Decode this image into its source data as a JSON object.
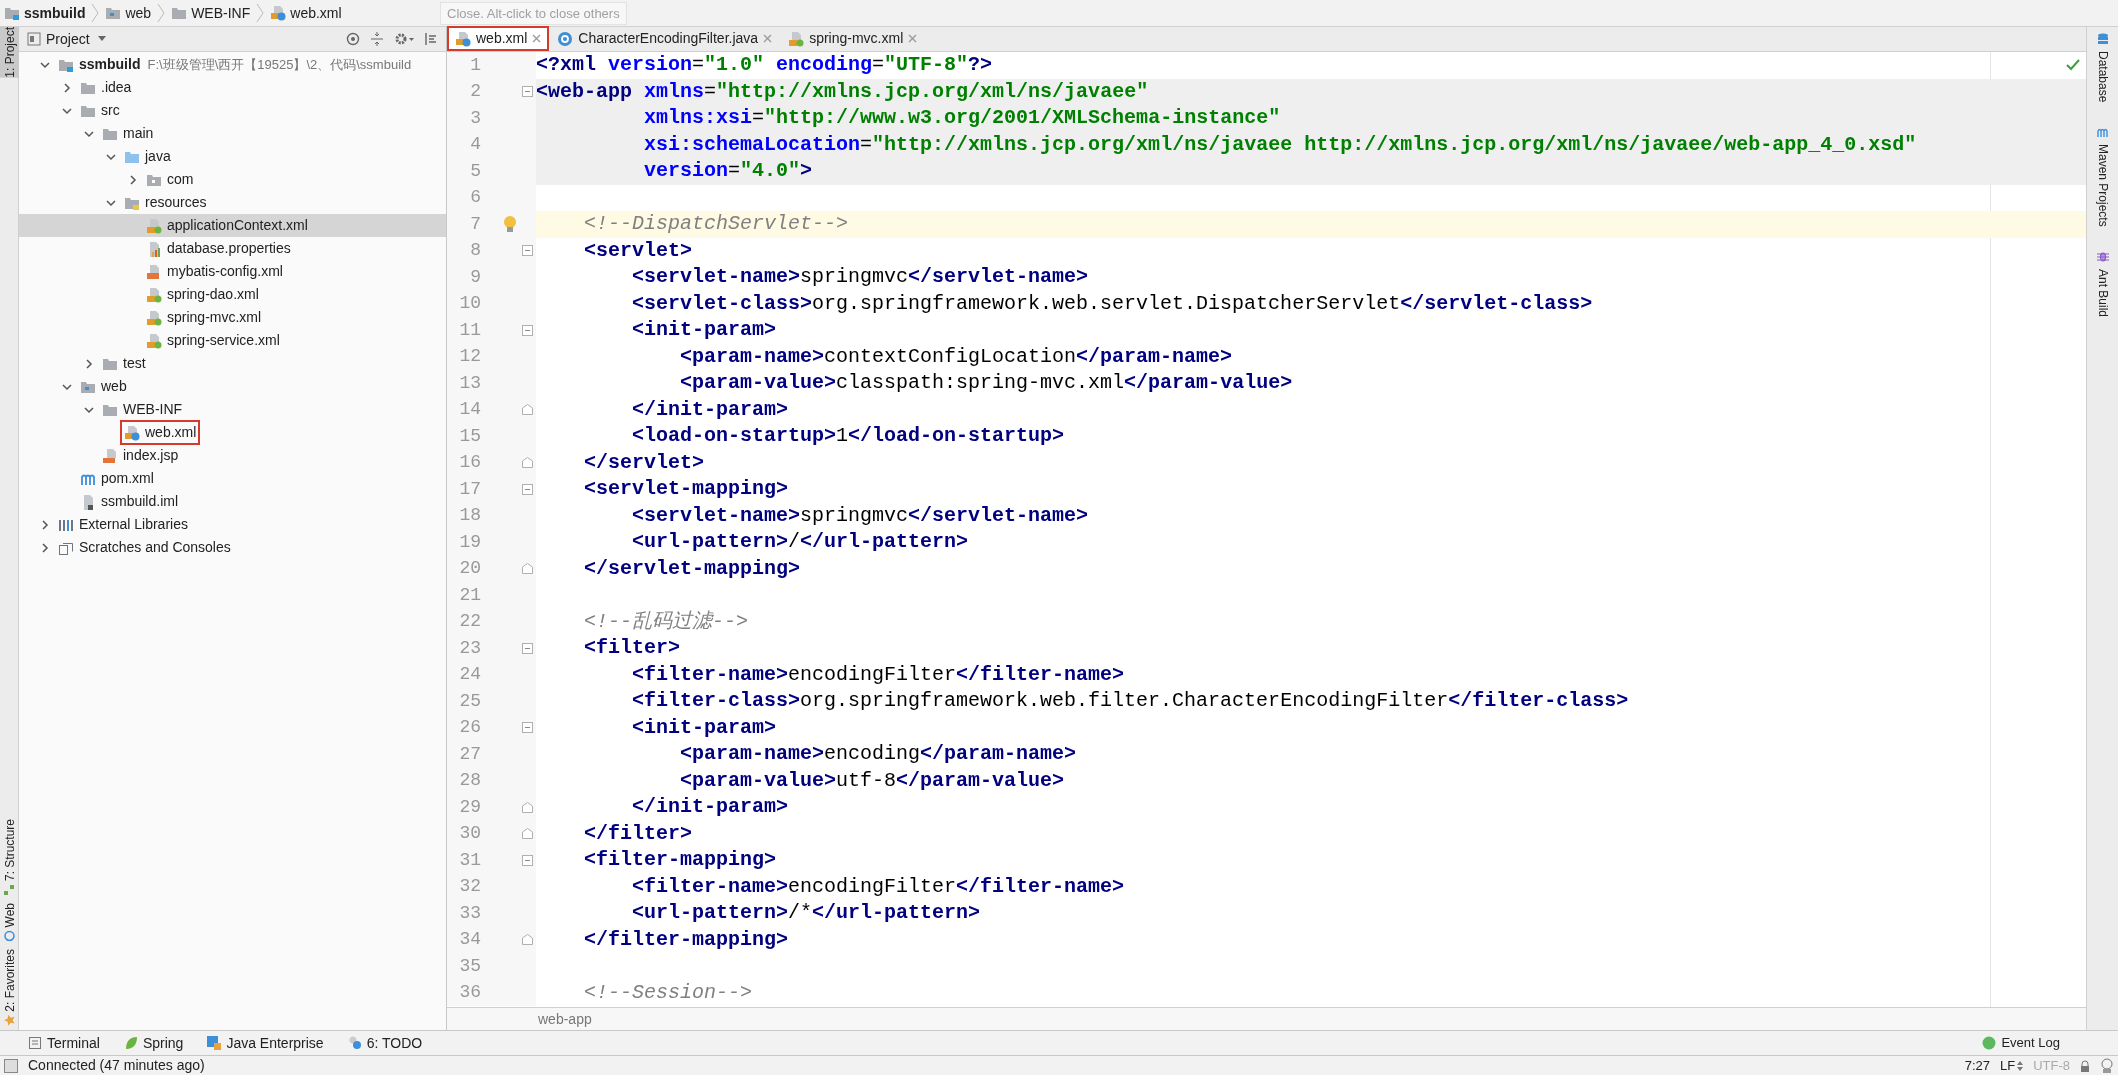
{
  "breadcrumbs": [
    {
      "label": "ssmbuild",
      "kind": "module"
    },
    {
      "label": "web",
      "kind": "folder-web"
    },
    {
      "label": "WEB-INF",
      "kind": "folder"
    },
    {
      "label": "web.xml",
      "kind": "xml-web"
    }
  ],
  "tooltip": "Close. Alt-click to close others",
  "left_strip": {
    "top": [
      {
        "label": "1: Project",
        "selected": true
      }
    ],
    "bottom": [
      {
        "label": "2: Favorites",
        "kind": "star"
      },
      {
        "label": "Web",
        "kind": "web"
      },
      {
        "label": "7: Structure",
        "kind": "structure"
      }
    ]
  },
  "project": {
    "title": "Project",
    "tree": [
      {
        "label": "ssmbuild",
        "path": "F:\\班级管理\\西开【19525】\\2、代码\\ssmbuild",
        "kind": "module",
        "expanded": true,
        "selected": false,
        "children": [
          {
            "label": ".idea",
            "kind": "folder",
            "expanded": false,
            "selected": false
          },
          {
            "label": "src",
            "kind": "folder",
            "expanded": true,
            "selected": false,
            "children": [
              {
                "label": "main",
                "kind": "folder",
                "expanded": true,
                "selected": false,
                "children": [
                  {
                    "label": "java",
                    "kind": "folder-source",
                    "expanded": true,
                    "selected": false,
                    "children": [
                      {
                        "label": "com",
                        "kind": "package",
                        "expanded": false,
                        "selected": false
                      }
                    ]
                  },
                  {
                    "label": "resources",
                    "kind": "folder-resources",
                    "expanded": true,
                    "selected": false,
                    "children": [
                      {
                        "label": "applicationContext.xml",
                        "kind": "xml-spring",
                        "selected": true
                      },
                      {
                        "label": "database.properties",
                        "kind": "properties",
                        "selected": false
                      },
                      {
                        "label": "mybatis-config.xml",
                        "kind": "xml-plain",
                        "selected": false
                      },
                      {
                        "label": "spring-dao.xml",
                        "kind": "xml-spring",
                        "selected": false
                      },
                      {
                        "label": "spring-mvc.xml",
                        "kind": "xml-spring",
                        "selected": false
                      },
                      {
                        "label": "spring-service.xml",
                        "kind": "xml-spring",
                        "selected": false
                      }
                    ]
                  }
                ]
              },
              {
                "label": "test",
                "kind": "folder",
                "expanded": false,
                "selected": false
              }
            ]
          },
          {
            "label": "web",
            "kind": "folder-web",
            "expanded": true,
            "selected": false,
            "children": [
              {
                "label": "WEB-INF",
                "kind": "folder",
                "expanded": true,
                "selected": false,
                "children": [
                  {
                    "label": "web.xml",
                    "kind": "xml-web",
                    "selected": false,
                    "marked": true
                  }
                ]
              },
              {
                "label": "index.jsp",
                "kind": "jsp",
                "selected": false
              }
            ]
          },
          {
            "label": "pom.xml",
            "kind": "maven",
            "selected": false
          },
          {
            "label": "ssmbuild.iml",
            "kind": "iml",
            "selected": false
          }
        ]
      },
      {
        "label": "External Libraries",
        "kind": "libraries",
        "expanded": false,
        "selected": false
      },
      {
        "label": "Scratches and Consoles",
        "kind": "scratches",
        "expanded": false,
        "selected": false
      }
    ]
  },
  "tabs": [
    {
      "label": "web.xml",
      "kind": "xml-web",
      "selected": true,
      "marked": true
    },
    {
      "label": "CharacterEncodingFilter.java",
      "kind": "java",
      "selected": false,
      "marked": false
    },
    {
      "label": "spring-mvc.xml",
      "kind": "xml-spring",
      "selected": false,
      "marked": false
    }
  ],
  "code": [
    {
      "number": "1",
      "tokens": [
        {
          "kind": "tag",
          "text": "<?xml "
        },
        {
          "kind": "attr",
          "text": "version"
        },
        {
          "kind": "text",
          "text": "="
        },
        {
          "kind": "value",
          "text": "\"1.0\" "
        },
        {
          "kind": "attr",
          "text": "encoding"
        },
        {
          "kind": "text",
          "text": "="
        },
        {
          "kind": "value",
          "text": "\"UTF-8\""
        },
        {
          "kind": "tag",
          "text": "?>"
        }
      ]
    },
    {
      "number": "2",
      "tag_scope": true,
      "fold_start": true,
      "tokens": [
        {
          "kind": "tag",
          "text": "<web-app "
        },
        {
          "kind": "attr",
          "text": "xmlns"
        },
        {
          "kind": "text",
          "text": "="
        },
        {
          "kind": "value",
          "text": "\"http://xmlns.jcp.org/xml/ns/javaee\""
        }
      ]
    },
    {
      "number": "3",
      "tag_scope": true,
      "tokens": [
        {
          "kind": "attr",
          "text": "         xmlns:xsi"
        },
        {
          "kind": "text",
          "text": "="
        },
        {
          "kind": "value",
          "text": "\"http://www.w3.org/2001/XMLSchema-instance\""
        }
      ]
    },
    {
      "number": "4",
      "tag_scope": true,
      "tokens": [
        {
          "kind": "attr",
          "text": "         xsi:schemaLocation"
        },
        {
          "kind": "text",
          "text": "="
        },
        {
          "kind": "value",
          "text": "\"http://xmlns.jcp.org/xml/ns/javaee http://xmlns.jcp.org/xml/ns/javaee/web-app_4_0.xsd\""
        }
      ]
    },
    {
      "number": "5",
      "tag_scope": true,
      "tokens": [
        {
          "kind": "attr",
          "text": "         version"
        },
        {
          "kind": "text",
          "text": "="
        },
        {
          "kind": "value",
          "text": "\"4.0\""
        },
        {
          "kind": "tag",
          "text": ">"
        }
      ]
    },
    {
      "number": "6"
    },
    {
      "number": "7",
      "caret_line": true,
      "bulb": true,
      "tokens": [
        {
          "kind": "comment",
          "text": "    <!--DispatchServlet-->"
        }
      ]
    },
    {
      "number": "8",
      "fold_start": true,
      "tokens": [
        {
          "kind": "tag",
          "text": "    <servlet>"
        }
      ]
    },
    {
      "number": "9",
      "tokens": [
        {
          "kind": "tag",
          "text": "        <servlet-name>"
        },
        {
          "kind": "text",
          "text": "springmvc"
        },
        {
          "kind": "tag",
          "text": "</servlet-name>"
        }
      ]
    },
    {
      "number": "10",
      "tokens": [
        {
          "kind": "tag",
          "text": "        <servlet-class>"
        },
        {
          "kind": "text",
          "text": "org.springframework.web.servlet.DispatcherServlet"
        },
        {
          "kind": "tag",
          "text": "</servlet-class>"
        }
      ]
    },
    {
      "number": "11",
      "fold_start": true,
      "tokens": [
        {
          "kind": "tag",
          "text": "        <init-param>"
        }
      ]
    },
    {
      "number": "12",
      "tokens": [
        {
          "kind": "tag",
          "text": "            <param-name>"
        },
        {
          "kind": "text",
          "text": "contextConfigLocation"
        },
        {
          "kind": "tag",
          "text": "</param-name>"
        }
      ]
    },
    {
      "number": "13",
      "tokens": [
        {
          "kind": "tag",
          "text": "            <param-value>"
        },
        {
          "kind": "text",
          "text": "classpath:spring-mvc.xml"
        },
        {
          "kind": "tag",
          "text": "</param-value>"
        }
      ]
    },
    {
      "number": "14",
      "fold_end": true,
      "tokens": [
        {
          "kind": "tag",
          "text": "        </init-param>"
        }
      ]
    },
    {
      "number": "15",
      "tokens": [
        {
          "kind": "tag",
          "text": "        <load-on-startup>"
        },
        {
          "kind": "text",
          "text": "1"
        },
        {
          "kind": "tag",
          "text": "</load-on-startup>"
        }
      ]
    },
    {
      "number": "16",
      "fold_end": true,
      "tokens": [
        {
          "kind": "tag",
          "text": "    </servlet>"
        }
      ]
    },
    {
      "number": "17",
      "fold_start": true,
      "tokens": [
        {
          "kind": "tag",
          "text": "    <servlet-mapping>"
        }
      ]
    },
    {
      "number": "18",
      "tokens": [
        {
          "kind": "tag",
          "text": "        <servlet-name>"
        },
        {
          "kind": "text",
          "text": "springmvc"
        },
        {
          "kind": "tag",
          "text": "</servlet-name>"
        }
      ]
    },
    {
      "number": "19",
      "tokens": [
        {
          "kind": "tag",
          "text": "        <url-pattern>"
        },
        {
          "kind": "text",
          "text": "/"
        },
        {
          "kind": "tag",
          "text": "</url-pattern>"
        }
      ]
    },
    {
      "number": "20",
      "fold_end": true,
      "tokens": [
        {
          "kind": "tag",
          "text": "    </servlet-mapping>"
        }
      ]
    },
    {
      "number": "21"
    },
    {
      "number": "22",
      "tokens": [
        {
          "kind": "comment",
          "text": "    <!--乱码过滤-->"
        }
      ]
    },
    {
      "number": "23",
      "fold_start": true,
      "tokens": [
        {
          "kind": "tag",
          "text": "    <filter>"
        }
      ]
    },
    {
      "number": "24",
      "tokens": [
        {
          "kind": "tag",
          "text": "        <filter-name>"
        },
        {
          "kind": "text",
          "text": "encodingFilter"
        },
        {
          "kind": "tag",
          "text": "</filter-name>"
        }
      ]
    },
    {
      "number": "25",
      "tokens": [
        {
          "kind": "tag",
          "text": "        <filter-class>"
        },
        {
          "kind": "text",
          "text": "org.springframework.web.filter.CharacterEncodingFilter"
        },
        {
          "kind": "tag",
          "text": "</filter-class>"
        }
      ]
    },
    {
      "number": "26",
      "fold_start": true,
      "tokens": [
        {
          "kind": "tag",
          "text": "        <init-param>"
        }
      ]
    },
    {
      "number": "27",
      "tokens": [
        {
          "kind": "tag",
          "text": "            <param-name>"
        },
        {
          "kind": "text",
          "text": "encoding"
        },
        {
          "kind": "tag",
          "text": "</param-name>"
        }
      ]
    },
    {
      "number": "28",
      "tokens": [
        {
          "kind": "tag",
          "text": "            <param-value>"
        },
        {
          "kind": "text",
          "text": "utf-8"
        },
        {
          "kind": "tag",
          "text": "</param-value>"
        }
      ]
    },
    {
      "number": "29",
      "fold_end": true,
      "tokens": [
        {
          "kind": "tag",
          "text": "        </init-param>"
        }
      ]
    },
    {
      "number": "30",
      "fold_end": true,
      "tokens": [
        {
          "kind": "tag",
          "text": "    </filter>"
        }
      ]
    },
    {
      "number": "31",
      "fold_start": true,
      "tokens": [
        {
          "kind": "tag",
          "text": "    <filter-mapping>"
        }
      ]
    },
    {
      "number": "32",
      "tokens": [
        {
          "kind": "tag",
          "text": "        <filter-name>"
        },
        {
          "kind": "text",
          "text": "encodingFilter"
        },
        {
          "kind": "tag",
          "text": "</filter-name>"
        }
      ]
    },
    {
      "number": "33",
      "tokens": [
        {
          "kind": "tag",
          "text": "        <url-pattern>"
        },
        {
          "kind": "text",
          "text": "/*"
        },
        {
          "kind": "tag",
          "text": "</url-pattern>"
        }
      ]
    },
    {
      "number": "34",
      "fold_end": true,
      "tokens": [
        {
          "kind": "tag",
          "text": "    </filter-mapping>"
        }
      ]
    },
    {
      "number": "35"
    },
    {
      "number": "36",
      "tokens": [
        {
          "kind": "comment",
          "text": "    <!--Session-->"
        }
      ]
    }
  ],
  "editor_breadcrumb": "web-app",
  "right_strip": [
    {
      "label": "Database",
      "kind": "database"
    },
    {
      "label": "Maven Projects",
      "kind": "maven"
    },
    {
      "label": "Ant Build",
      "kind": "ant"
    }
  ],
  "tool_windows": [
    {
      "label": "Terminal",
      "kind": "terminal"
    },
    {
      "label": "Spring",
      "kind": "spring"
    },
    {
      "label": "Java Enterprise",
      "kind": "javaee"
    },
    {
      "label": "6: TODO",
      "kind": "todo"
    }
  ],
  "event_log": "Event Log",
  "status": {
    "message": "Connected (47 minutes ago)",
    "position": "7:27",
    "line_separator": "LF",
    "encoding": "UTF-8"
  }
}
